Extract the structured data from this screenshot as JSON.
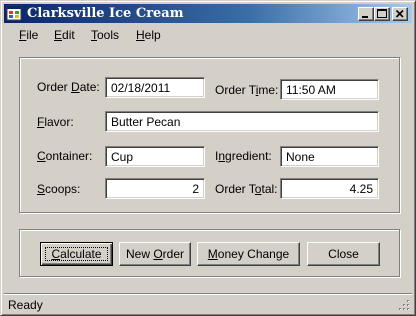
{
  "window": {
    "title": "Clarksville Ice Cream",
    "icon": "app-icon"
  },
  "menu": [
    {
      "label": "File",
      "mnemonic": "F",
      "rest": "ile"
    },
    {
      "label": "Edit",
      "mnemonic": "E",
      "rest": "dit"
    },
    {
      "label": "Tools",
      "mnemonic": "T",
      "rest": "ools"
    },
    {
      "label": "Help",
      "mnemonic": "H",
      "rest": "elp"
    }
  ],
  "order": {
    "date_label_pre": "Order ",
    "date_label_ul": "D",
    "date_label_post": "ate:",
    "date_value": "02/18/2011",
    "time_label_pre": "Order T",
    "time_label_ul": "i",
    "time_label_post": "me:",
    "time_value": "11:50 AM",
    "flavor_label_ul": "F",
    "flavor_label_post": "lavor:",
    "flavor_value": "Butter Pecan",
    "container_label_ul": "C",
    "container_label_post": "ontainer:",
    "container_value": "Cup",
    "ingredient_label_pre": "I",
    "ingredient_label_ul": "n",
    "ingredient_label_post": "gredient:",
    "ingredient_value": "None",
    "scoops_label_ul": "S",
    "scoops_label_post": "coops:",
    "scoops_value": "2",
    "total_label_pre": "Order T",
    "total_label_ul": "o",
    "total_label_post": "tal:",
    "total_value": "4.25"
  },
  "buttons": {
    "calculate_ul": "C",
    "calculate_rest": "alculate",
    "new_order_pre": "New ",
    "new_order_ul": "O",
    "new_order_post": "rder",
    "money_change_ul": "M",
    "money_change_rest": "oney Change",
    "close": "Close"
  },
  "status": {
    "text": "Ready"
  },
  "colors": {
    "title_bar_start": "#0a246a",
    "title_bar_end": "#a6caf0",
    "face": "#d4d0c8"
  }
}
